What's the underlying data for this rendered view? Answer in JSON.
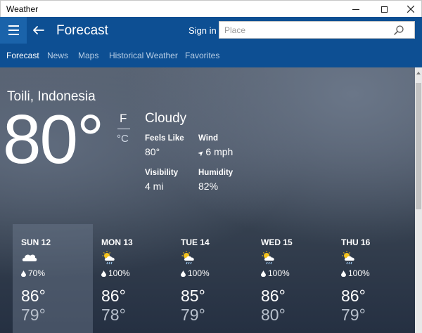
{
  "window": {
    "title": "Weather"
  },
  "appbar": {
    "title": "Forecast",
    "signin": "Sign in",
    "search_placeholder": "Place"
  },
  "nav": {
    "items": [
      {
        "label": "Forecast",
        "active": true
      },
      {
        "label": "News"
      },
      {
        "label": "Maps"
      },
      {
        "label": "Historical Weather"
      },
      {
        "label": "Favorites"
      }
    ]
  },
  "current": {
    "location": "Toili, Indonesia",
    "temperature": "80°",
    "unit_primary": "F",
    "unit_secondary": "°C",
    "condition": "Cloudy",
    "feels_like_label": "Feels Like",
    "feels_like": "80°",
    "wind_label": "Wind",
    "wind": "6 mph",
    "visibility_label": "Visibility",
    "visibility": "4 mi",
    "humidity_label": "Humidity",
    "humidity": "82%"
  },
  "forecast": [
    {
      "day": "SUN 12",
      "icon": "cloudy-icon",
      "precip": "70%",
      "high": "86°",
      "low": "79°",
      "selected": true
    },
    {
      "day": "MON 13",
      "icon": "sun-rain-icon",
      "precip": "100%",
      "high": "86°",
      "low": "78°"
    },
    {
      "day": "TUE 14",
      "icon": "sun-rain-icon",
      "precip": "100%",
      "high": "85°",
      "low": "79°"
    },
    {
      "day": "WED 15",
      "icon": "sun-rain-icon",
      "precip": "100%",
      "high": "86°",
      "low": "80°"
    },
    {
      "day": "THU 16",
      "icon": "sun-rain-icon",
      "precip": "100%",
      "high": "86°",
      "low": "79°"
    }
  ],
  "colors": {
    "header": "#0d4f93",
    "hamburger": "#1a63aa",
    "sun": "#f4c21d"
  }
}
